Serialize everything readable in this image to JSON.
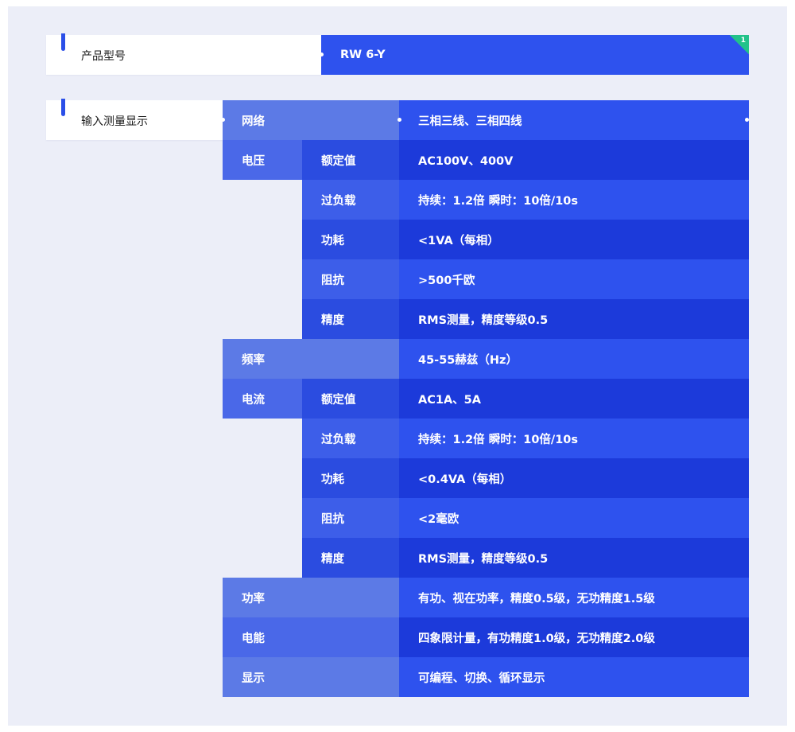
{
  "model": {
    "label": "产品型号",
    "value": "RW 6-Y",
    "badge": "1"
  },
  "input": {
    "label": "输入测量显示",
    "network": {
      "label": "网络",
      "value": "三相三线、三相四线"
    },
    "voltage": {
      "label": "电压",
      "rows": [
        {
          "name": "额定值",
          "value": "AC100V、400V"
        },
        {
          "name": "过负载",
          "value": "持续：1.2倍 瞬时：10倍/10s"
        },
        {
          "name": "功耗",
          "value": "<1VA（每相）"
        },
        {
          "name": "阻抗",
          "value": ">500千欧"
        },
        {
          "name": "精度",
          "value": "RMS测量，精度等级0.5"
        }
      ]
    },
    "frequency": {
      "label": "频率",
      "value": "45-55赫兹（Hz）"
    },
    "current": {
      "label": "电流",
      "rows": [
        {
          "name": "额定值",
          "value": "AC1A、5A"
        },
        {
          "name": "过负载",
          "value": "持续：1.2倍 瞬时：10倍/10s"
        },
        {
          "name": "功耗",
          "value": "<0.4VA（每相）"
        },
        {
          "name": "阻抗",
          "value": "<2毫欧"
        },
        {
          "name": "精度",
          "value": "RMS测量，精度等级0.5"
        }
      ]
    },
    "power": {
      "label": "功率",
      "value": "有功、视在功率，精度0.5级，无功精度1.5级"
    },
    "energy": {
      "label": "电能",
      "value": "四象限计量，有功精度1.0级，无功精度2.0级"
    },
    "display": {
      "label": "显示",
      "value": "可编程、切换、循环显示"
    }
  },
  "colors": {
    "accent": "#2b4fe8",
    "value_row_light": "#2e52ee",
    "value_row_dark": "#1c3ada",
    "level1_cell": "#5c7ae6",
    "corner_badge": "#22c28a",
    "background": "#eceef8"
  }
}
